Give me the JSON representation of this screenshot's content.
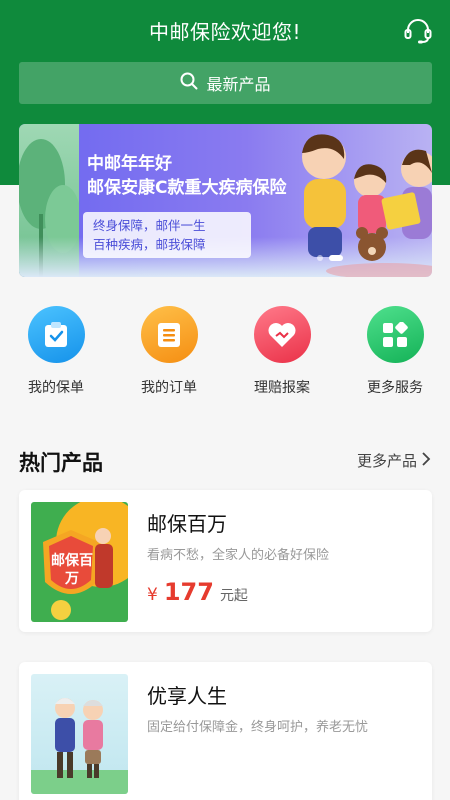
{
  "header": {
    "title": "中邮保险欢迎您!",
    "support_icon": "headset-icon"
  },
  "search": {
    "label": "最新产品",
    "icon": "search-icon"
  },
  "banner": {
    "headline1": "中邮年年好",
    "headline2": "邮保安康C款重大疾病保险",
    "tag_line1": "终身保障，邮伴一生",
    "tag_line2": "百种疾病，邮我保障",
    "active_slide": 1,
    "slide_count": 2
  },
  "shortcuts": [
    {
      "label": "我的保单",
      "icon": "policy-icon",
      "color": "#1fa3f2"
    },
    {
      "label": "我的订单",
      "icon": "order-icon",
      "color": "#f7a21a"
    },
    {
      "label": "理赔报案",
      "icon": "claim-heart-icon",
      "color": "#f0485b"
    },
    {
      "label": "更多服务",
      "icon": "more-services-icon",
      "color": "#25c76a"
    }
  ],
  "hot": {
    "title": "热门产品",
    "more_label": "更多产品"
  },
  "products": [
    {
      "name": "邮保百万",
      "desc": "看病不愁，全家人的必备好保险",
      "currency": "¥",
      "price": "177",
      "unit": "元起",
      "thumb_text": "邮保百万"
    },
    {
      "name": "优享人生",
      "desc": "固定给付保障金，终身呵护，养老无忧"
    }
  ],
  "colors": {
    "brand_green": "#0f8a3c",
    "price_red": "#e63b2e"
  }
}
